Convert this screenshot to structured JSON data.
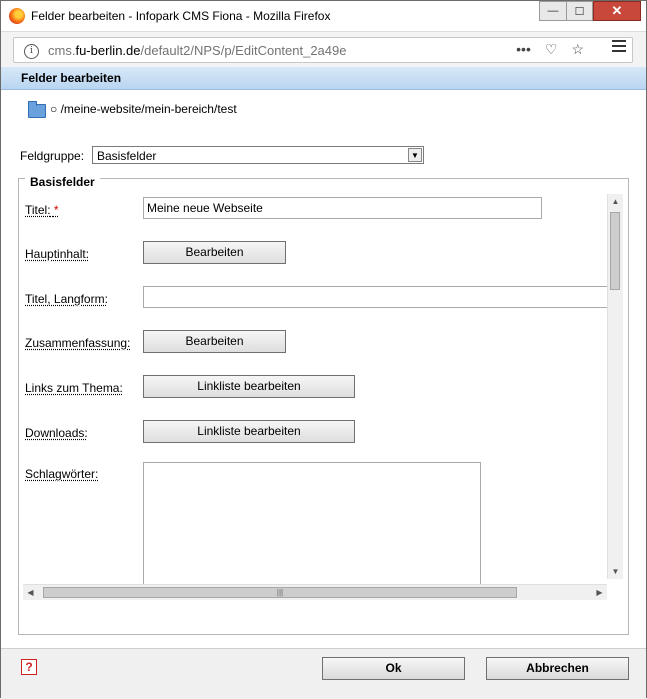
{
  "window": {
    "title": "Felder bearbeiten - Infopark CMS Fiona - Mozilla Firefox",
    "minimize_glyph": "—",
    "maximize_glyph": "☐",
    "close_glyph": "✕"
  },
  "urlbar": {
    "info_glyph": "i",
    "url_prefix": "cms.",
    "url_host": "fu-berlin.de",
    "url_path": "/default2/NPS/p/EditContent_2a49e",
    "more_glyph": "•••",
    "pocket_glyph": "♡",
    "star_glyph": "☆"
  },
  "dialog": {
    "header_title": "Felder bearbeiten",
    "path": "○ /meine-website/mein-bereich/test",
    "fieldgroup_label": "Feldgruppe:",
    "fieldgroup_value": "Basisfelder",
    "fieldset_legend": "Basisfelder"
  },
  "fields": {
    "titel_label": "Titel:",
    "titel_required": "*",
    "titel_value": "Meine neue Webseite",
    "hauptinhalt_label": "Hauptinhalt:",
    "hauptinhalt_button": "Bearbeiten",
    "langform_label": "Titel, Langform:",
    "langform_value": "",
    "zusammenfassung_label": "Zusammenfassung:",
    "zusammenfassung_button": "Bearbeiten",
    "links_label": "Links zum Thema:",
    "links_button": "Linkliste bearbeiten",
    "downloads_label": "Downloads:",
    "downloads_button": "Linkliste bearbeiten",
    "schlagwoerter_label": "Schlagwörter:"
  },
  "scroll": {
    "up_glyph": "▲",
    "down_glyph": "▼",
    "left_glyph": "◀",
    "right_glyph": "▶",
    "grip_glyph": "|||"
  },
  "footer": {
    "help_glyph": "?",
    "ok_label": "Ok",
    "cancel_label": "Abbrechen"
  }
}
